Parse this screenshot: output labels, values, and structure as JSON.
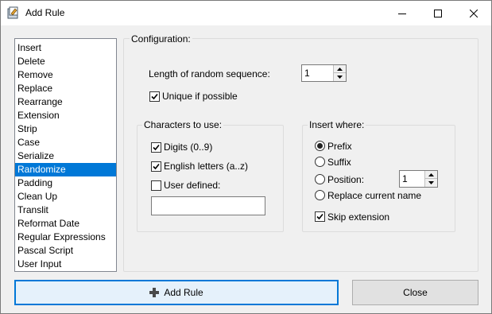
{
  "window": {
    "title": "Add Rule"
  },
  "rules_list": {
    "items": [
      "Insert",
      "Delete",
      "Remove",
      "Replace",
      "Rearrange",
      "Extension",
      "Strip",
      "Case",
      "Serialize",
      "Randomize",
      "Padding",
      "Clean Up",
      "Translit",
      "Reformat Date",
      "Regular Expressions",
      "Pascal Script",
      "User Input"
    ],
    "selected": "Randomize"
  },
  "configuration": {
    "legend": "Configuration:",
    "length_label": "Length of random sequence:",
    "length_value": "1",
    "unique_label": "Unique if possible",
    "unique_checked": true
  },
  "characters": {
    "legend": "Characters to use:",
    "digits_label": "Digits (0..9)",
    "digits_checked": true,
    "letters_label": "English letters (a..z)",
    "letters_checked": true,
    "user_defined_label": "User defined:",
    "user_defined_checked": false,
    "user_defined_value": ""
  },
  "insert_where": {
    "legend": "Insert where:",
    "prefix_label": "Prefix",
    "suffix_label": "Suffix",
    "position_label": "Position:",
    "position_value": "1",
    "replace_label": "Replace current name",
    "selected": "Prefix",
    "skip_ext_label": "Skip extension",
    "skip_ext_checked": true
  },
  "buttons": {
    "add_rule": "Add Rule",
    "close": "Close"
  },
  "colors": {
    "selection": "#0078d7",
    "accent": "#0078d7"
  }
}
